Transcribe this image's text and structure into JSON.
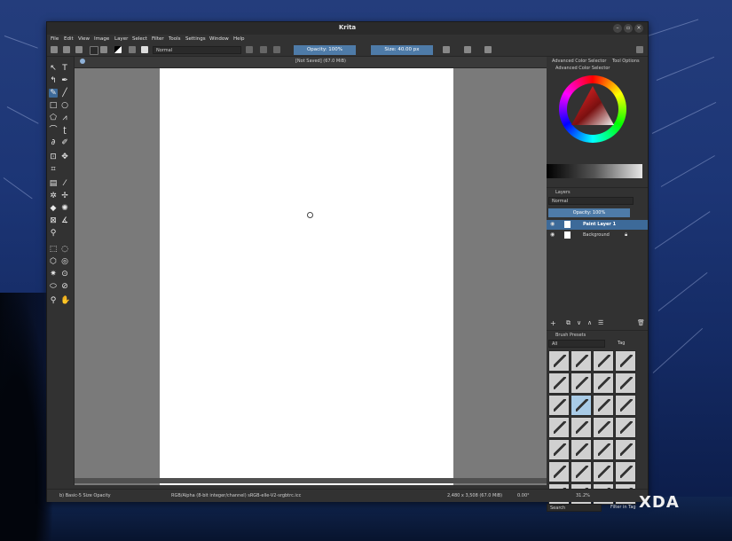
{
  "window": {
    "title": "Krita"
  },
  "menu": [
    "File",
    "Edit",
    "View",
    "Image",
    "Layer",
    "Select",
    "Filter",
    "Tools",
    "Settings",
    "Window",
    "Help"
  ],
  "toolbar": {
    "blend_mode": "Normal",
    "opacity_label": "Opacity: 100%",
    "size_label": "Size: 40.00 px"
  },
  "canvas": {
    "tab_title": "[Not Saved]  (67.0 MiB)"
  },
  "dock": {
    "tabs": [
      "Advanced Color Selector",
      "Tool Options"
    ],
    "color_selector_title": "Advanced Color Selector",
    "layers_title": "Layers",
    "layers_blend_mode": "Normal",
    "layers_opacity": "Opacity:  100%",
    "layers": [
      {
        "name": "Paint Layer 1",
        "selected": true
      },
      {
        "name": "Background",
        "selected": false
      }
    ],
    "brush_presets_title": "Brush Presets",
    "brush_filter": "All",
    "brush_tag_label": "Tag",
    "search_placeholder": "Search",
    "filter_in_tag": "Filter in Tag"
  },
  "status": {
    "brush": "b) Basic-5 Size Opacity",
    "color_space": "RGB/Alpha (8-bit integer/channel)  sRGB-elle-V2-srgbtrc.icc",
    "dimensions": "2,480 x 3,508 (67.0 MiB)",
    "rotation": "0.00°",
    "zoom": "31.2%"
  },
  "watermark": "XDA",
  "colors": {
    "accent": "#4e7ba8",
    "window_bg": "#323232",
    "canvas_bg": "#7a7a7a",
    "paper": "#ffffff"
  }
}
